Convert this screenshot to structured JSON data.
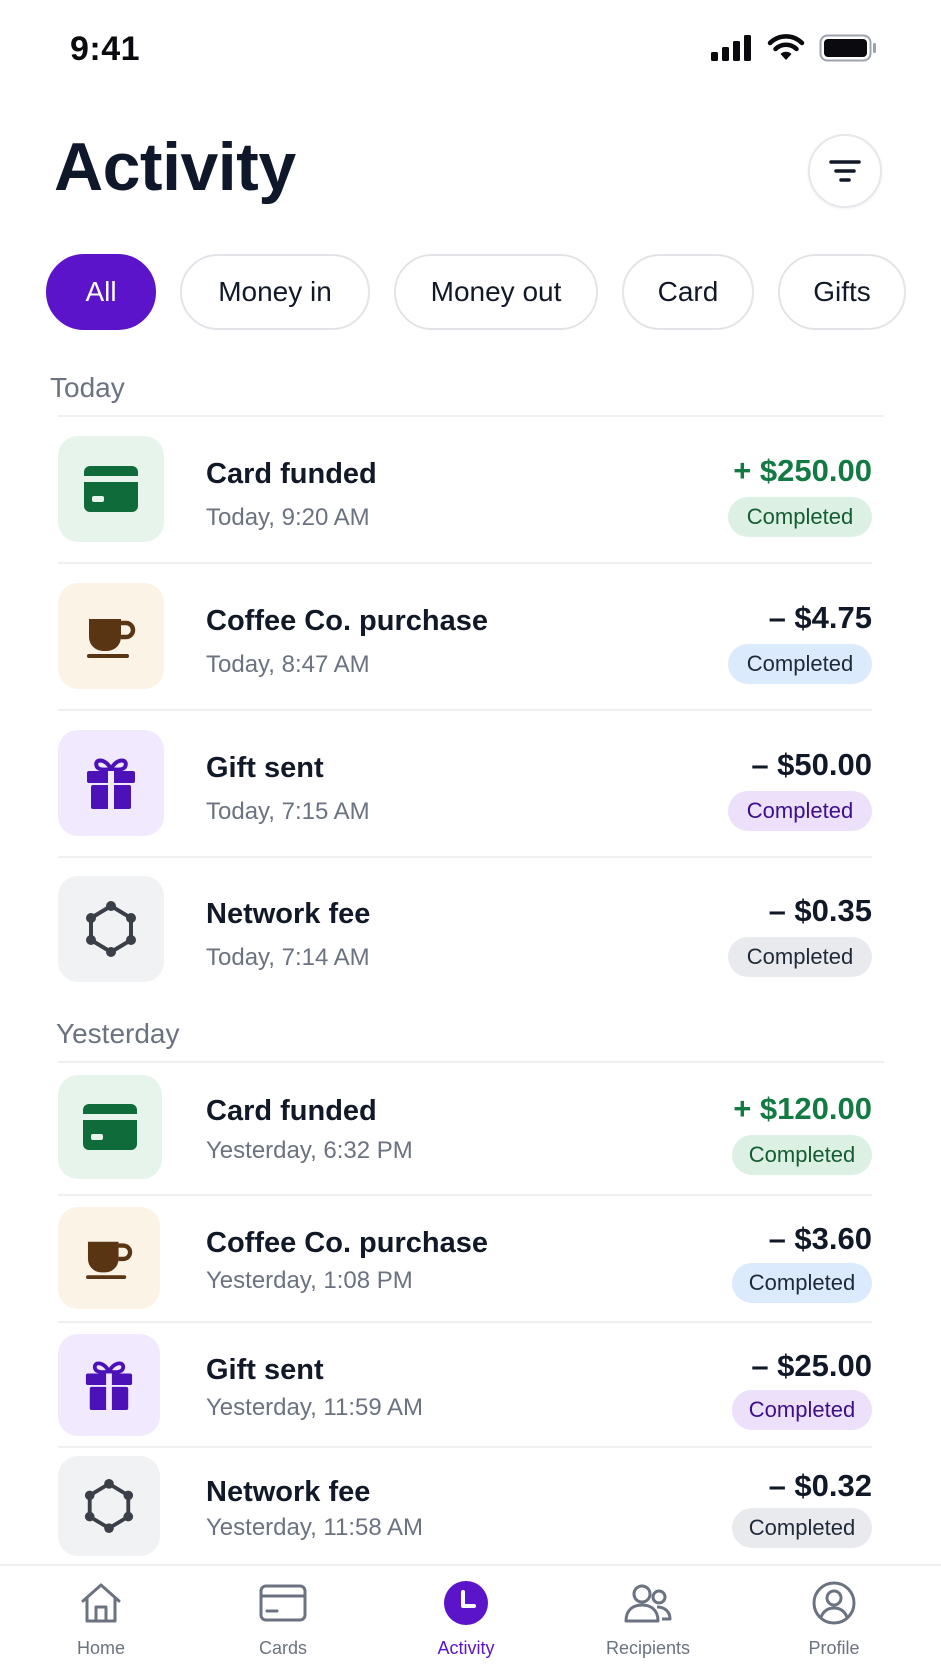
{
  "status_bar": {
    "time": "9:41"
  },
  "header": {
    "title": "Activity",
    "filter_icon": "filter-icon"
  },
  "filters": [
    {
      "label": "All",
      "active": true
    },
    {
      "label": "Money in",
      "active": false
    },
    {
      "label": "Money out",
      "active": false
    },
    {
      "label": "Card",
      "active": false
    },
    {
      "label": "Gifts",
      "active": false
    }
  ],
  "sections": [
    {
      "label": "Today",
      "items": [
        {
          "title": "Card funded",
          "time": "Today, 9:20 AM",
          "amount": "+ $250.00",
          "status": "Completed",
          "icon": "card-icon",
          "direction": "in"
        },
        {
          "title": "Coffee Co. purchase",
          "time": "Today, 8:47 AM",
          "amount": "– $4.75",
          "status": "Completed",
          "icon": "coffee-cup-icon",
          "direction": "out"
        },
        {
          "title": "Gift sent",
          "time": "Today, 7:15 AM",
          "amount": "– $50.00",
          "status": "Completed",
          "icon": "gift-icon",
          "direction": "out"
        },
        {
          "title": "Network fee",
          "time": "Today, 7:14 AM",
          "amount": "– $0.35",
          "status": "Completed",
          "icon": "network-icon",
          "direction": "out"
        }
      ]
    },
    {
      "label": "Yesterday",
      "items": [
        {
          "title": "Card funded",
          "time": "Yesterday, 6:32 PM",
          "amount": "+ $120.00",
          "status": "Completed",
          "icon": "card-icon",
          "direction": "in"
        },
        {
          "title": "Coffee Co. purchase",
          "time": "Yesterday, 1:08 PM",
          "amount": "– $3.60",
          "status": "Completed",
          "icon": "coffee-cup-icon",
          "direction": "out"
        },
        {
          "title": "Gift sent",
          "time": "Yesterday, 11:59 AM",
          "amount": "– $25.00",
          "status": "Completed",
          "icon": "gift-icon",
          "direction": "out"
        },
        {
          "title": "Network fee",
          "time": "Yesterday, 11:58 AM",
          "amount": "– $0.32",
          "status": "Completed",
          "icon": "network-icon",
          "direction": "out"
        }
      ]
    }
  ],
  "tabbar": [
    {
      "label": "Home",
      "icon": "home-icon",
      "active": false
    },
    {
      "label": "Cards",
      "icon": "card-icon",
      "active": false
    },
    {
      "label": "Activity",
      "icon": "clock-icon",
      "active": true
    },
    {
      "label": "Recipients",
      "icon": "people-icon",
      "active": false
    },
    {
      "label": "Profile",
      "icon": "profile-icon",
      "active": false
    }
  ],
  "colors": {
    "accent": "#5b14c9",
    "positive": "#137a43"
  }
}
